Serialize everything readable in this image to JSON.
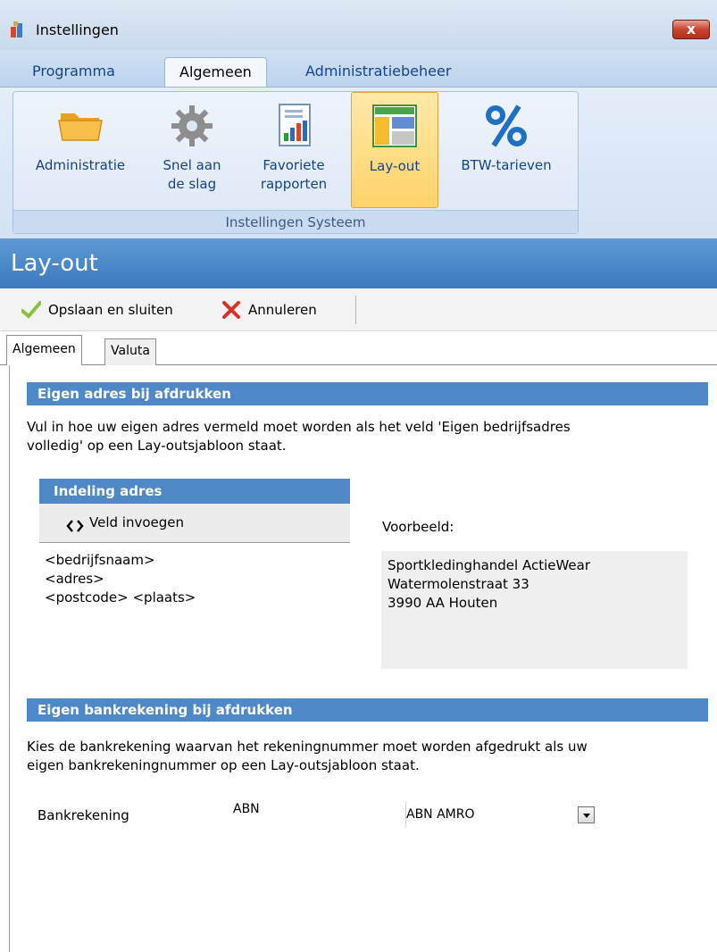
{
  "window": {
    "title": "Instellingen",
    "close_label": "x"
  },
  "ribbon": {
    "tabs": [
      {
        "label": "Programma"
      },
      {
        "label": "Algemeen"
      },
      {
        "label": "Administratiebeheer"
      }
    ],
    "group_label": "Instellingen Systeem",
    "buttons": [
      {
        "line1": "Administratie",
        "line2": "",
        "icon": "folder-icon"
      },
      {
        "line1": "Snel aan",
        "line2": "de slag",
        "icon": "gear-icon"
      },
      {
        "line1": "Favoriete",
        "line2": "rapporten",
        "icon": "report-icon"
      },
      {
        "line1": "Lay-out",
        "line2": "",
        "icon": "layout-icon"
      },
      {
        "line1": "BTW-tarieven",
        "line2": "",
        "icon": "percent-icon"
      }
    ]
  },
  "page": {
    "title": "Lay-out"
  },
  "toolbar": {
    "save_label": "Opslaan en sluiten",
    "cancel_label": "Annuleren"
  },
  "tabs": [
    {
      "label": "Algemeen"
    },
    {
      "label": "Valuta"
    }
  ],
  "address_section": {
    "header": "Eigen adres bij afdrukken",
    "description_line1": "Vul in hoe uw eigen adres vermeld moet worden als het veld 'Eigen bedrijfsadres",
    "description_line2": "volledig' op een Lay-outsjabloon staat.",
    "layout_header": "Indeling adres",
    "insert_field_label": "Veld invoegen",
    "template_lines": [
      "<bedrijfsnaam>",
      "<adres>",
      "<postcode> <plaats>"
    ],
    "preview_label": "Voorbeeld:",
    "preview_lines": [
      "Sportkledinghandel ActieWear",
      "Watermolenstraat 33",
      "3990 AA Houten"
    ]
  },
  "bank_section": {
    "header": "Eigen bankrekening bij afdrukken",
    "description_line1": "Kies de bankrekening waarvan het rekeningnummer moet worden afgedrukt als uw",
    "description_line2": "eigen bankrekeningnummer op een Lay-outsjabloon staat.",
    "field_label": "Bankrekening",
    "account_code": "ABN",
    "account_name": "ABN AMRO"
  }
}
